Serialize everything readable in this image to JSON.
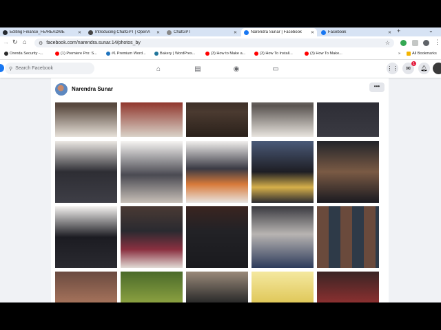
{
  "browser": {
    "tabs": [
      {
        "label": "Editing Finance_FE/README",
        "color": "#24292f"
      },
      {
        "label": "Introducing ChatGPT | OpenA",
        "color": "#444444"
      },
      {
        "label": "ChatGPT",
        "color": "#888888"
      },
      {
        "label": "Narendra Sunar | Facebook",
        "color": "#1877f2",
        "active": true
      },
      {
        "label": "Facebook",
        "color": "#1877f2"
      }
    ],
    "new_tab": "+",
    "address": "facebook.com/narendra.sunar.14/photos_by",
    "bookmarks": [
      {
        "label": "Orenda Security -...",
        "color": "#2a2a2a"
      },
      {
        "label": "(1) Premiere Pro: S...",
        "color": "#ff0000"
      },
      {
        "label": "#1 Premium Word...",
        "color": "#1e73be"
      },
      {
        "label": "Bakery | WordPres...",
        "color": "#21759b"
      },
      {
        "label": "(3) How to Make a...",
        "color": "#ff0000"
      },
      {
        "label": "(3) How To Install...",
        "color": "#ff0000"
      },
      {
        "label": "(3) How To Make...",
        "color": "#ff0000"
      }
    ],
    "bookmarks_more": "»",
    "all_bookmarks": "All Bookmarks"
  },
  "facebook": {
    "search_placeholder": "Search Facebook",
    "notification_count": "1",
    "profile_name": "Narendra Sunar",
    "more_label": "•••"
  },
  "photos": {
    "count": 20
  },
  "colors": {
    "fb_blue": "#1877f2",
    "fb_bg": "#f0f2f5",
    "badge_red": "#e41e3f"
  },
  "icons": [
    "github-icon",
    "openai-icon",
    "facebook-icon",
    "home-icon",
    "marketplace-icon",
    "groups-icon",
    "gaming-icon",
    "menu-grid-icon",
    "messenger-icon",
    "bell-icon"
  ]
}
